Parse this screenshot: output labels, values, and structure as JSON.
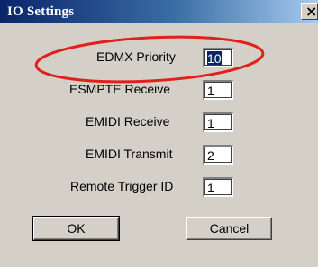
{
  "window": {
    "title": "IO Settings",
    "close_symbol": "×"
  },
  "fields": [
    {
      "label": "EDMX Priority",
      "value": "10",
      "selected": true
    },
    {
      "label": "ESMPTE Receive",
      "value": "1"
    },
    {
      "label": "EMIDI Receive",
      "value": "1"
    },
    {
      "label": "EMIDI Transmit",
      "value": "2"
    },
    {
      "label": "Remote Trigger ID",
      "value": "1"
    }
  ],
  "buttons": {
    "ok_label": "OK",
    "cancel_label": "Cancel"
  },
  "colors": {
    "title_bar_start": "#0a246a",
    "title_bar_end": "#a6caf0",
    "dialog_face": "#d4d0c8",
    "annotation_ellipse": "#e0201a"
  },
  "annotation": {
    "shape": "ellipse",
    "highlights": "EDMX Priority"
  }
}
